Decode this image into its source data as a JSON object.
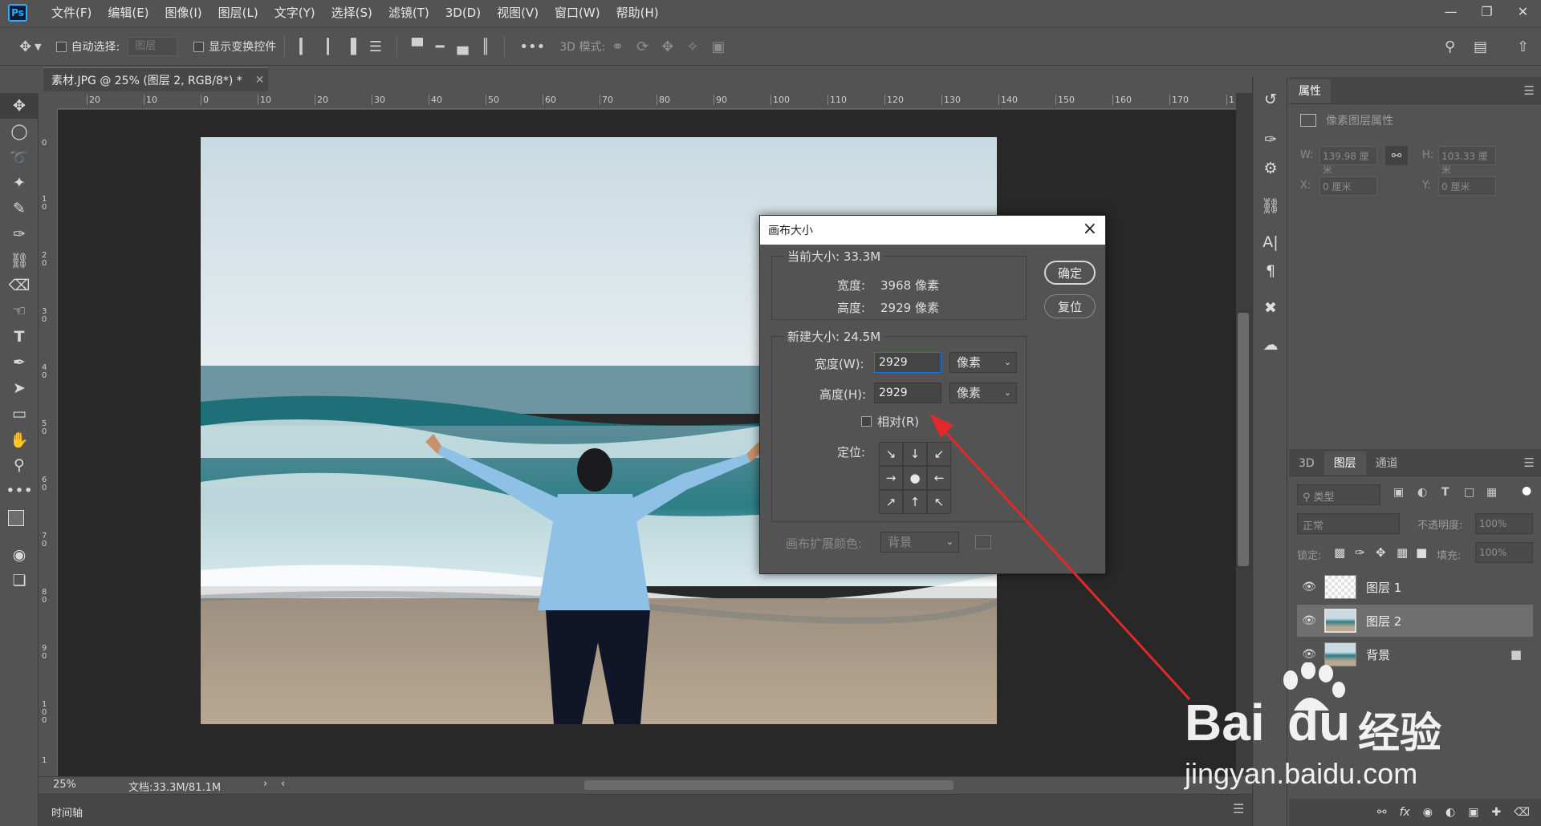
{
  "menubar": {
    "logo": "Ps",
    "items": [
      "文件(F)",
      "编辑(E)",
      "图像(I)",
      "图层(L)",
      "文字(Y)",
      "选择(S)",
      "滤镜(T)",
      "3D(D)",
      "视图(V)",
      "窗口(W)",
      "帮助(H)"
    ]
  },
  "optbar": {
    "auto_select_label": "自动选择:",
    "auto_select_value": "图层",
    "show_transform_label": "显示变换控件",
    "mode3d_label": "3D 模式:"
  },
  "doc": {
    "tab_title": "素材.JPG @ 25% (图层 2, RGB/8*) *",
    "ruler_top": [
      "20",
      "10",
      "0",
      "10",
      "20",
      "30",
      "40",
      "50",
      "60",
      "70",
      "80",
      "90",
      "100",
      "110",
      "120",
      "130",
      "140",
      "150",
      "160",
      "170",
      "1"
    ],
    "ruler_left": [
      "0",
      "1 0",
      "2 0",
      "3 0",
      "4 0",
      "5 0",
      "6 0",
      "7 0",
      "8 0",
      "9 0",
      "1 0 0",
      "1"
    ],
    "zoom": "25%",
    "doc_size": "文档:33.3M/81.1M",
    "timeline_label": "时间轴"
  },
  "dialog": {
    "title": "画布大小",
    "current_size_label": "当前大小: 33.3M",
    "current_width_label": "宽度:",
    "current_width_value": "3968 像素",
    "current_height_label": "高度:",
    "current_height_value": "2929 像素",
    "new_size_label": "新建大小: 24.5M",
    "width_label": "宽度(W):",
    "width_value": "2929",
    "width_unit": "像素",
    "height_label": "高度(H):",
    "height_value": "2929",
    "height_unit": "像素",
    "relative_label": "相对(R)",
    "anchor_label": "定位:",
    "extension_color_label": "画布扩展颜色:",
    "extension_color_value": "背景",
    "ok_button": "确定",
    "reset_button": "复位"
  },
  "properties_panel": {
    "tab": "属性",
    "section_title": "像素图层属性",
    "w_label": "W:",
    "w_value": "139.98 厘米",
    "h_label": "H:",
    "h_value": "103.33 厘米",
    "x_label": "X:",
    "x_value": "0 厘米",
    "y_label": "Y:",
    "y_value": "0 厘米"
  },
  "layers_panel": {
    "tabs": [
      "3D",
      "图层",
      "通道"
    ],
    "filter_label": "类型",
    "blend_mode": "正常",
    "opacity_label": "不透明度:",
    "opacity_value": "100%",
    "lock_label": "锁定:",
    "fill_label": "填充:",
    "fill_value": "100%",
    "layers": [
      {
        "name": "图层 1"
      },
      {
        "name": "图层 2"
      },
      {
        "name": "背景"
      }
    ]
  },
  "watermark": {
    "brand": "Bai",
    "brand2": "du",
    "suffix": "经验",
    "url": "jingyan.baidu.com"
  },
  "colors": {
    "annotation_arrow": "#e02a2a",
    "accent": "#1473e6"
  }
}
